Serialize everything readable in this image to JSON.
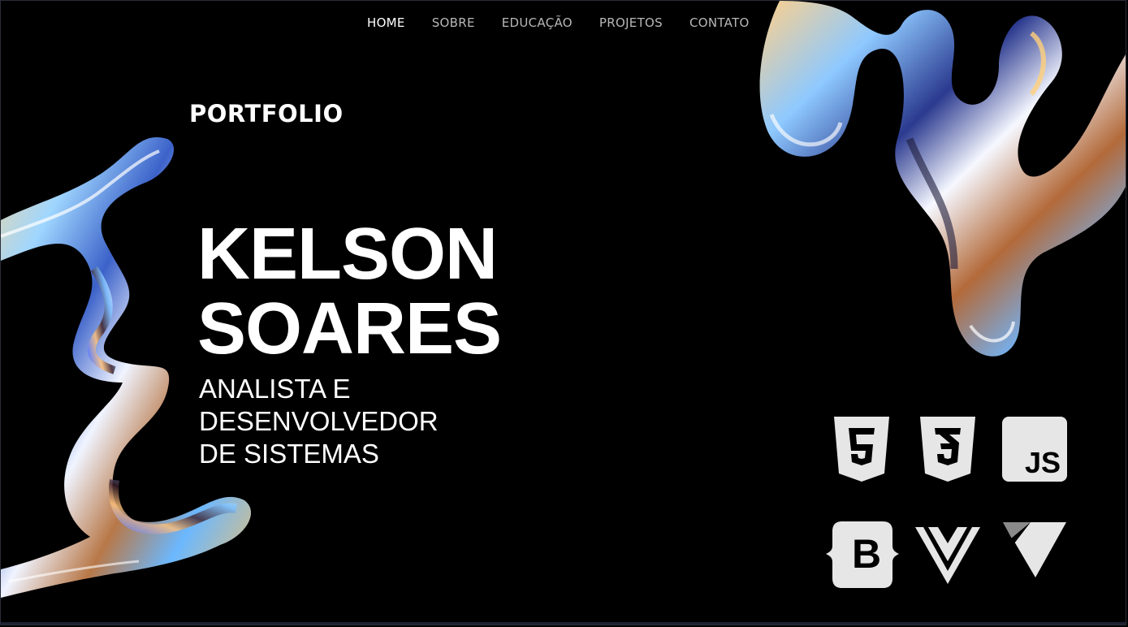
{
  "nav": {
    "items": [
      {
        "label": "HOME",
        "active": true
      },
      {
        "label": "SOBRE",
        "active": false
      },
      {
        "label": "EDUCAÇÃO",
        "active": false
      },
      {
        "label": "PROJETOS",
        "active": false
      },
      {
        "label": "CONTATO",
        "active": false
      }
    ]
  },
  "brand": "PORTFOLIO",
  "hero": {
    "name_line1": "KELSON",
    "name_line2": "SOARES",
    "role_line1": "ANALISTA E",
    "role_line2": "DESENVOLVEDOR",
    "role_line3": "DE SISTEMAS"
  },
  "tech_icons": {
    "html": "html5-icon",
    "css": "css3-icon",
    "js": "javascript-icon",
    "js_label": "JS",
    "bootstrap": "bootstrap-icon",
    "bootstrap_label": "B",
    "vue": "vue-icon",
    "vite": "vite-icon"
  },
  "colors": {
    "background": "#000000",
    "text": "#ffffff",
    "nav_inactive": "#b7b7b7",
    "icon": "#e6e6e6"
  }
}
